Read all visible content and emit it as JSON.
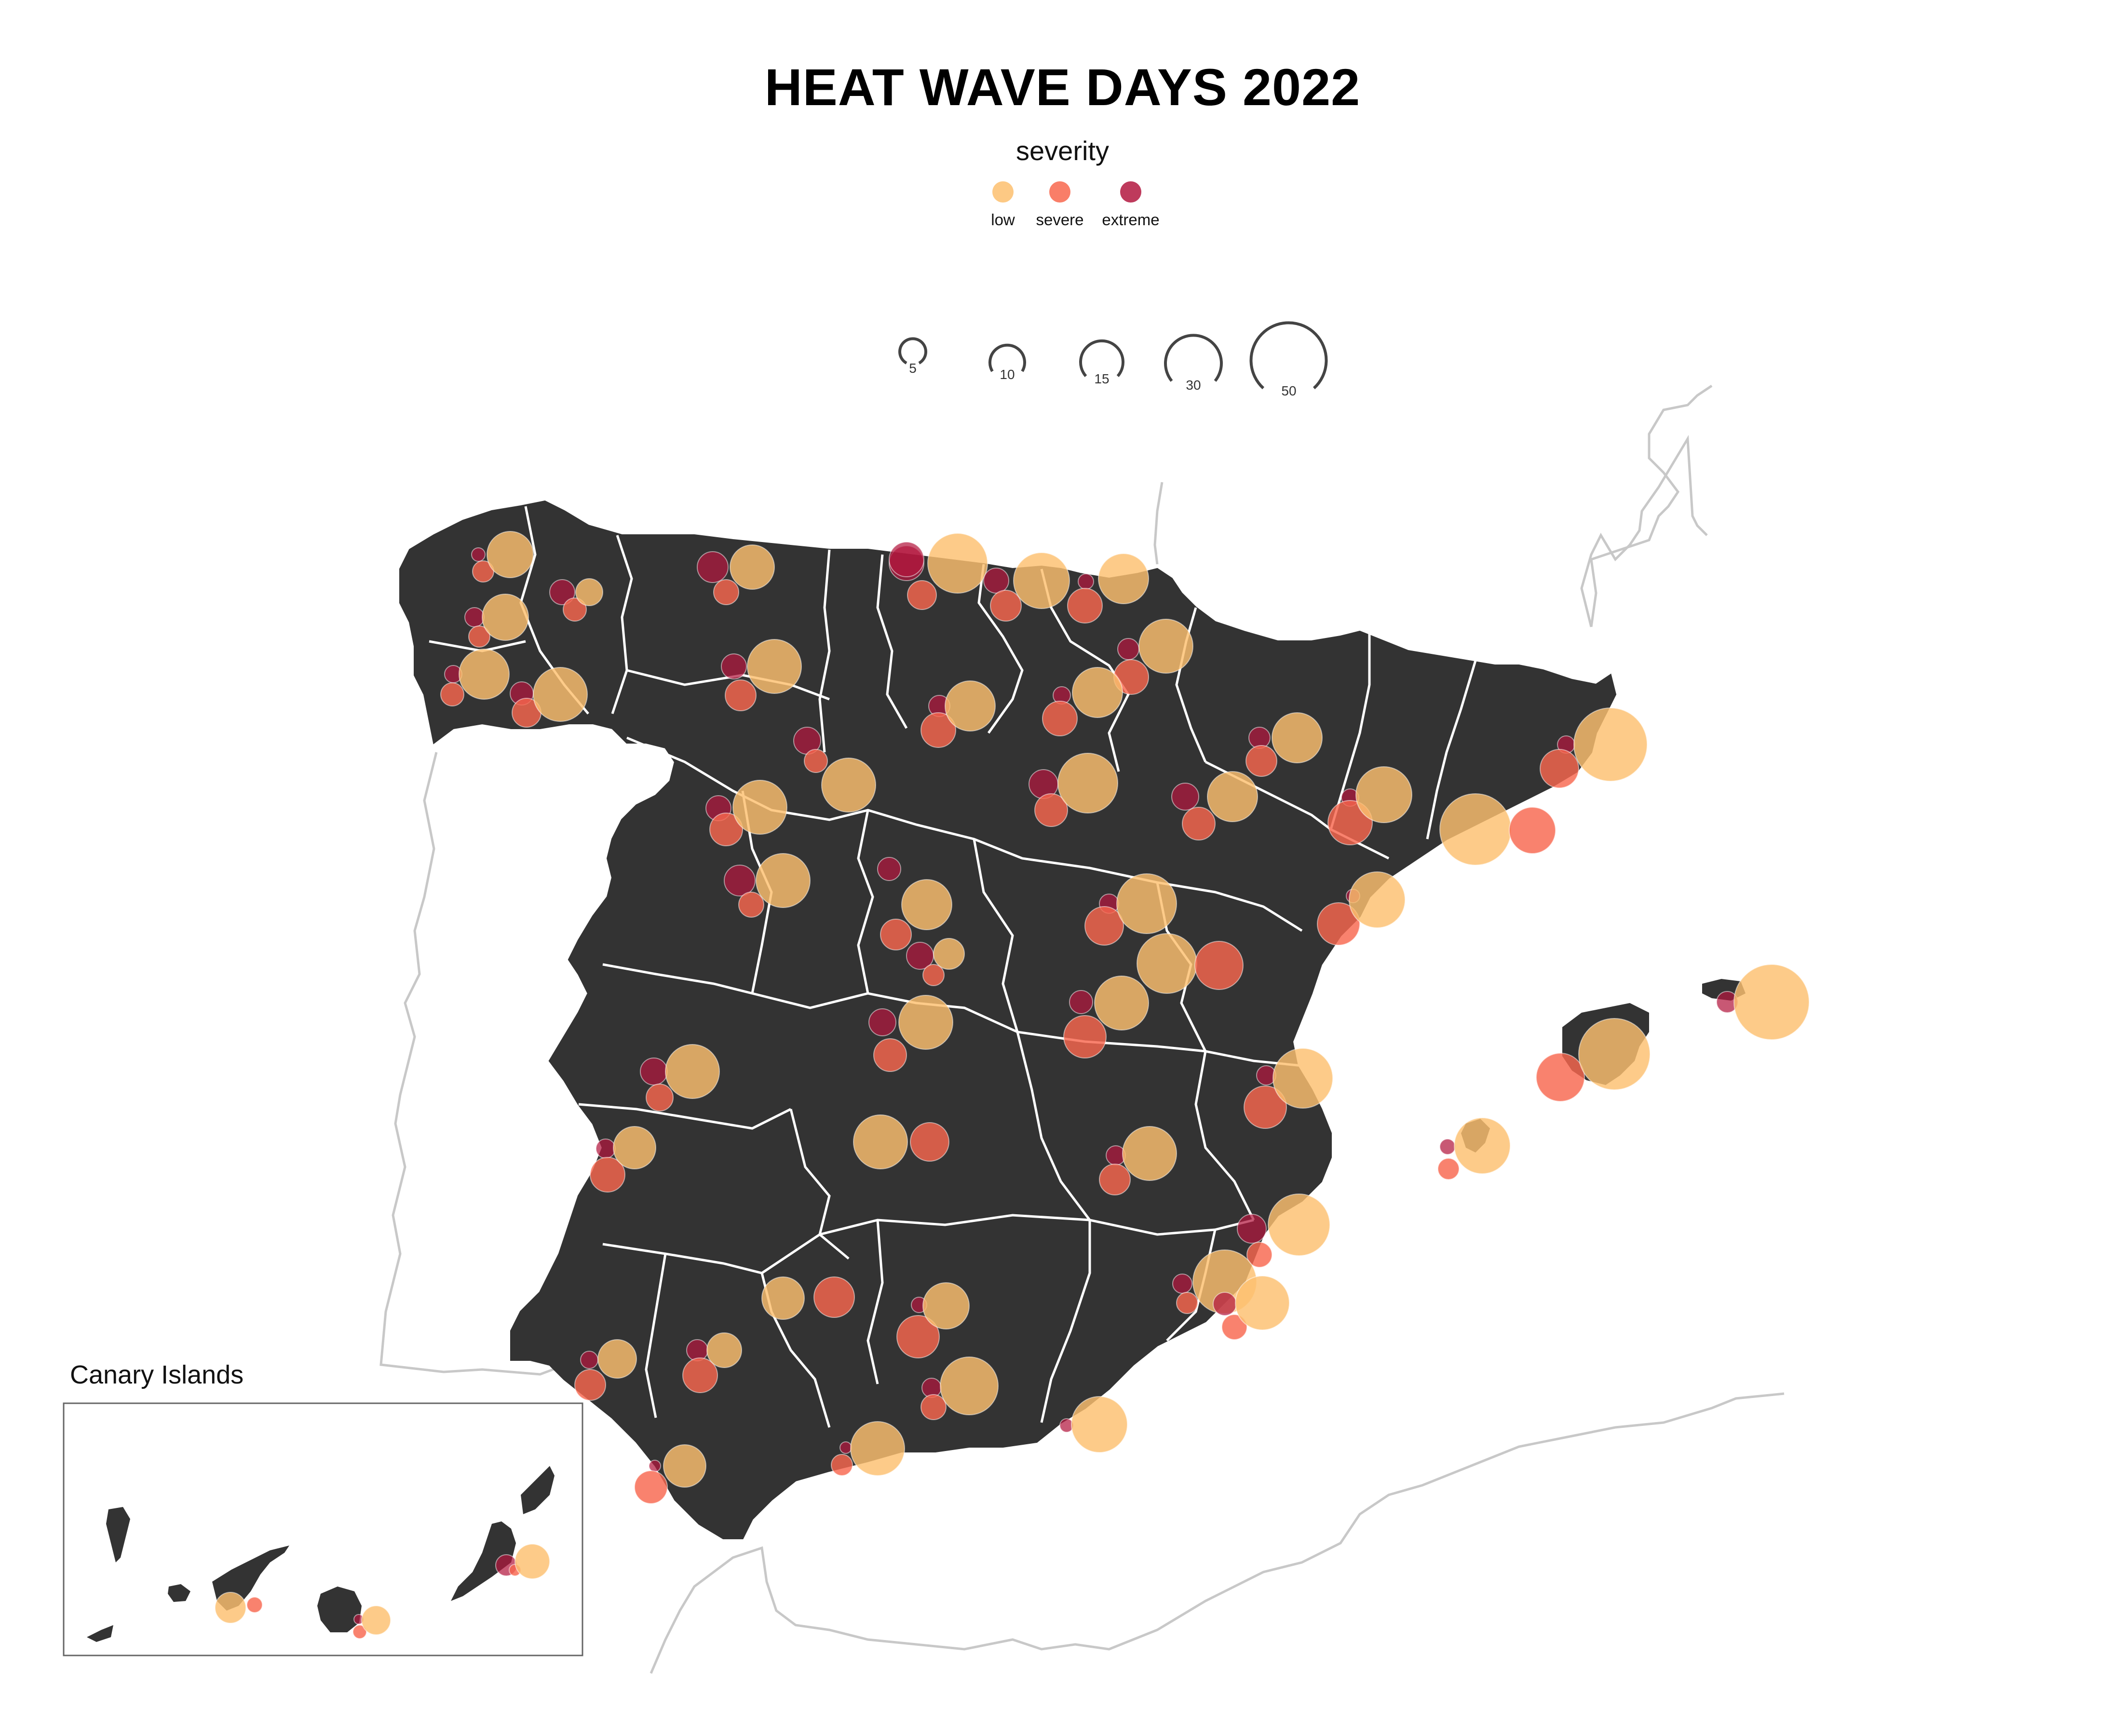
{
  "title": "HEAT WAVE DAYS 2022",
  "legend": {
    "title": "severity",
    "items": [
      {
        "label": "low",
        "color": "#FDBF6F"
      },
      {
        "label": "severe",
        "color": "#F8674E"
      },
      {
        "label": "extreme",
        "color": "#B3183F"
      }
    ],
    "size_values": [
      5,
      10,
      15,
      30,
      50
    ]
  },
  "inset": {
    "title": "Canary Islands"
  },
  "colors": {
    "land": "#333333",
    "borders": "#ffffff",
    "neighbors": "#cccccc",
    "low": "#FDBF6F",
    "severe": "#F8674E",
    "extreme": "#B3183F"
  }
}
